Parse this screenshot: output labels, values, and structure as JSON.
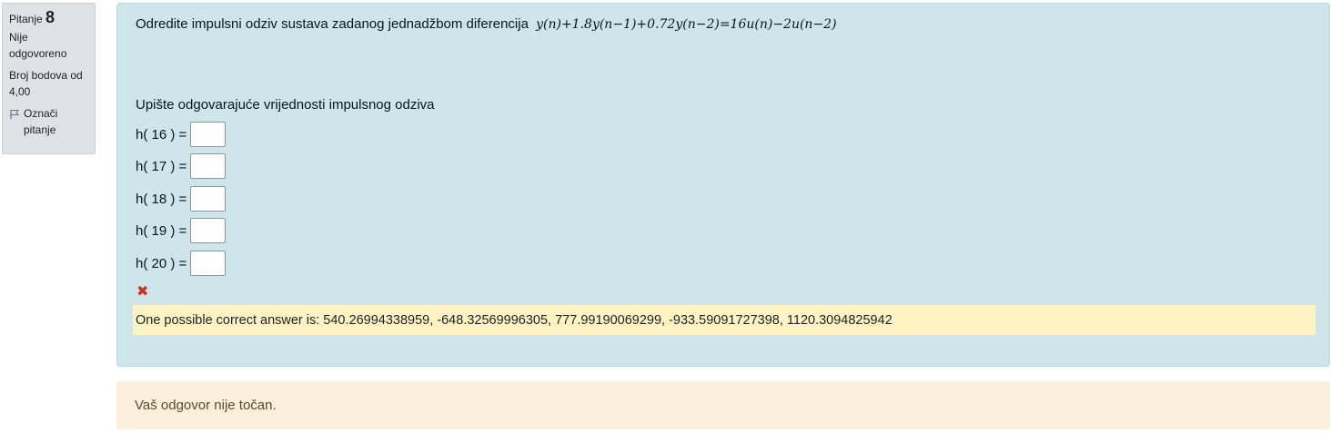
{
  "info": {
    "question_label": "Pitanje",
    "question_number": "8",
    "state": "Nije odgovoreno",
    "grade": "Broj bodova od 4,00",
    "flag_label": "Označi pitanje"
  },
  "question": {
    "text": "Odredite impulsni odziv sustava zadanog jednadžbom diferencija",
    "formula": "y(n)+1.8y(n−1)+0.72y(n−2)=16u(n)−2u(n−2)",
    "prompt": "Upište odgovarajuće vrijednosti impulsnog odziva",
    "rows": [
      {
        "label": "h( 16 ) =",
        "value": ""
      },
      {
        "label": "h( 17 ) =",
        "value": ""
      },
      {
        "label": "h( 18 ) =",
        "value": ""
      },
      {
        "label": "h( 19 ) =",
        "value": ""
      },
      {
        "label": "h( 20 ) =",
        "value": ""
      }
    ],
    "incorrect_icon": "cross-icon",
    "right_answer": "One possible correct answer is: 540.26994338959, -648.32569996305, 777.99190069299, -933.59091727398, 1120.3094825942"
  },
  "feedback": {
    "outcome": "Vaš odgovor nije točan."
  },
  "colors": {
    "formulation_bg": "#cee5ea",
    "right_answer_bg": "#fff3c4",
    "outcome_bg": "#fcefdc",
    "incorrect": "#ca3120"
  }
}
